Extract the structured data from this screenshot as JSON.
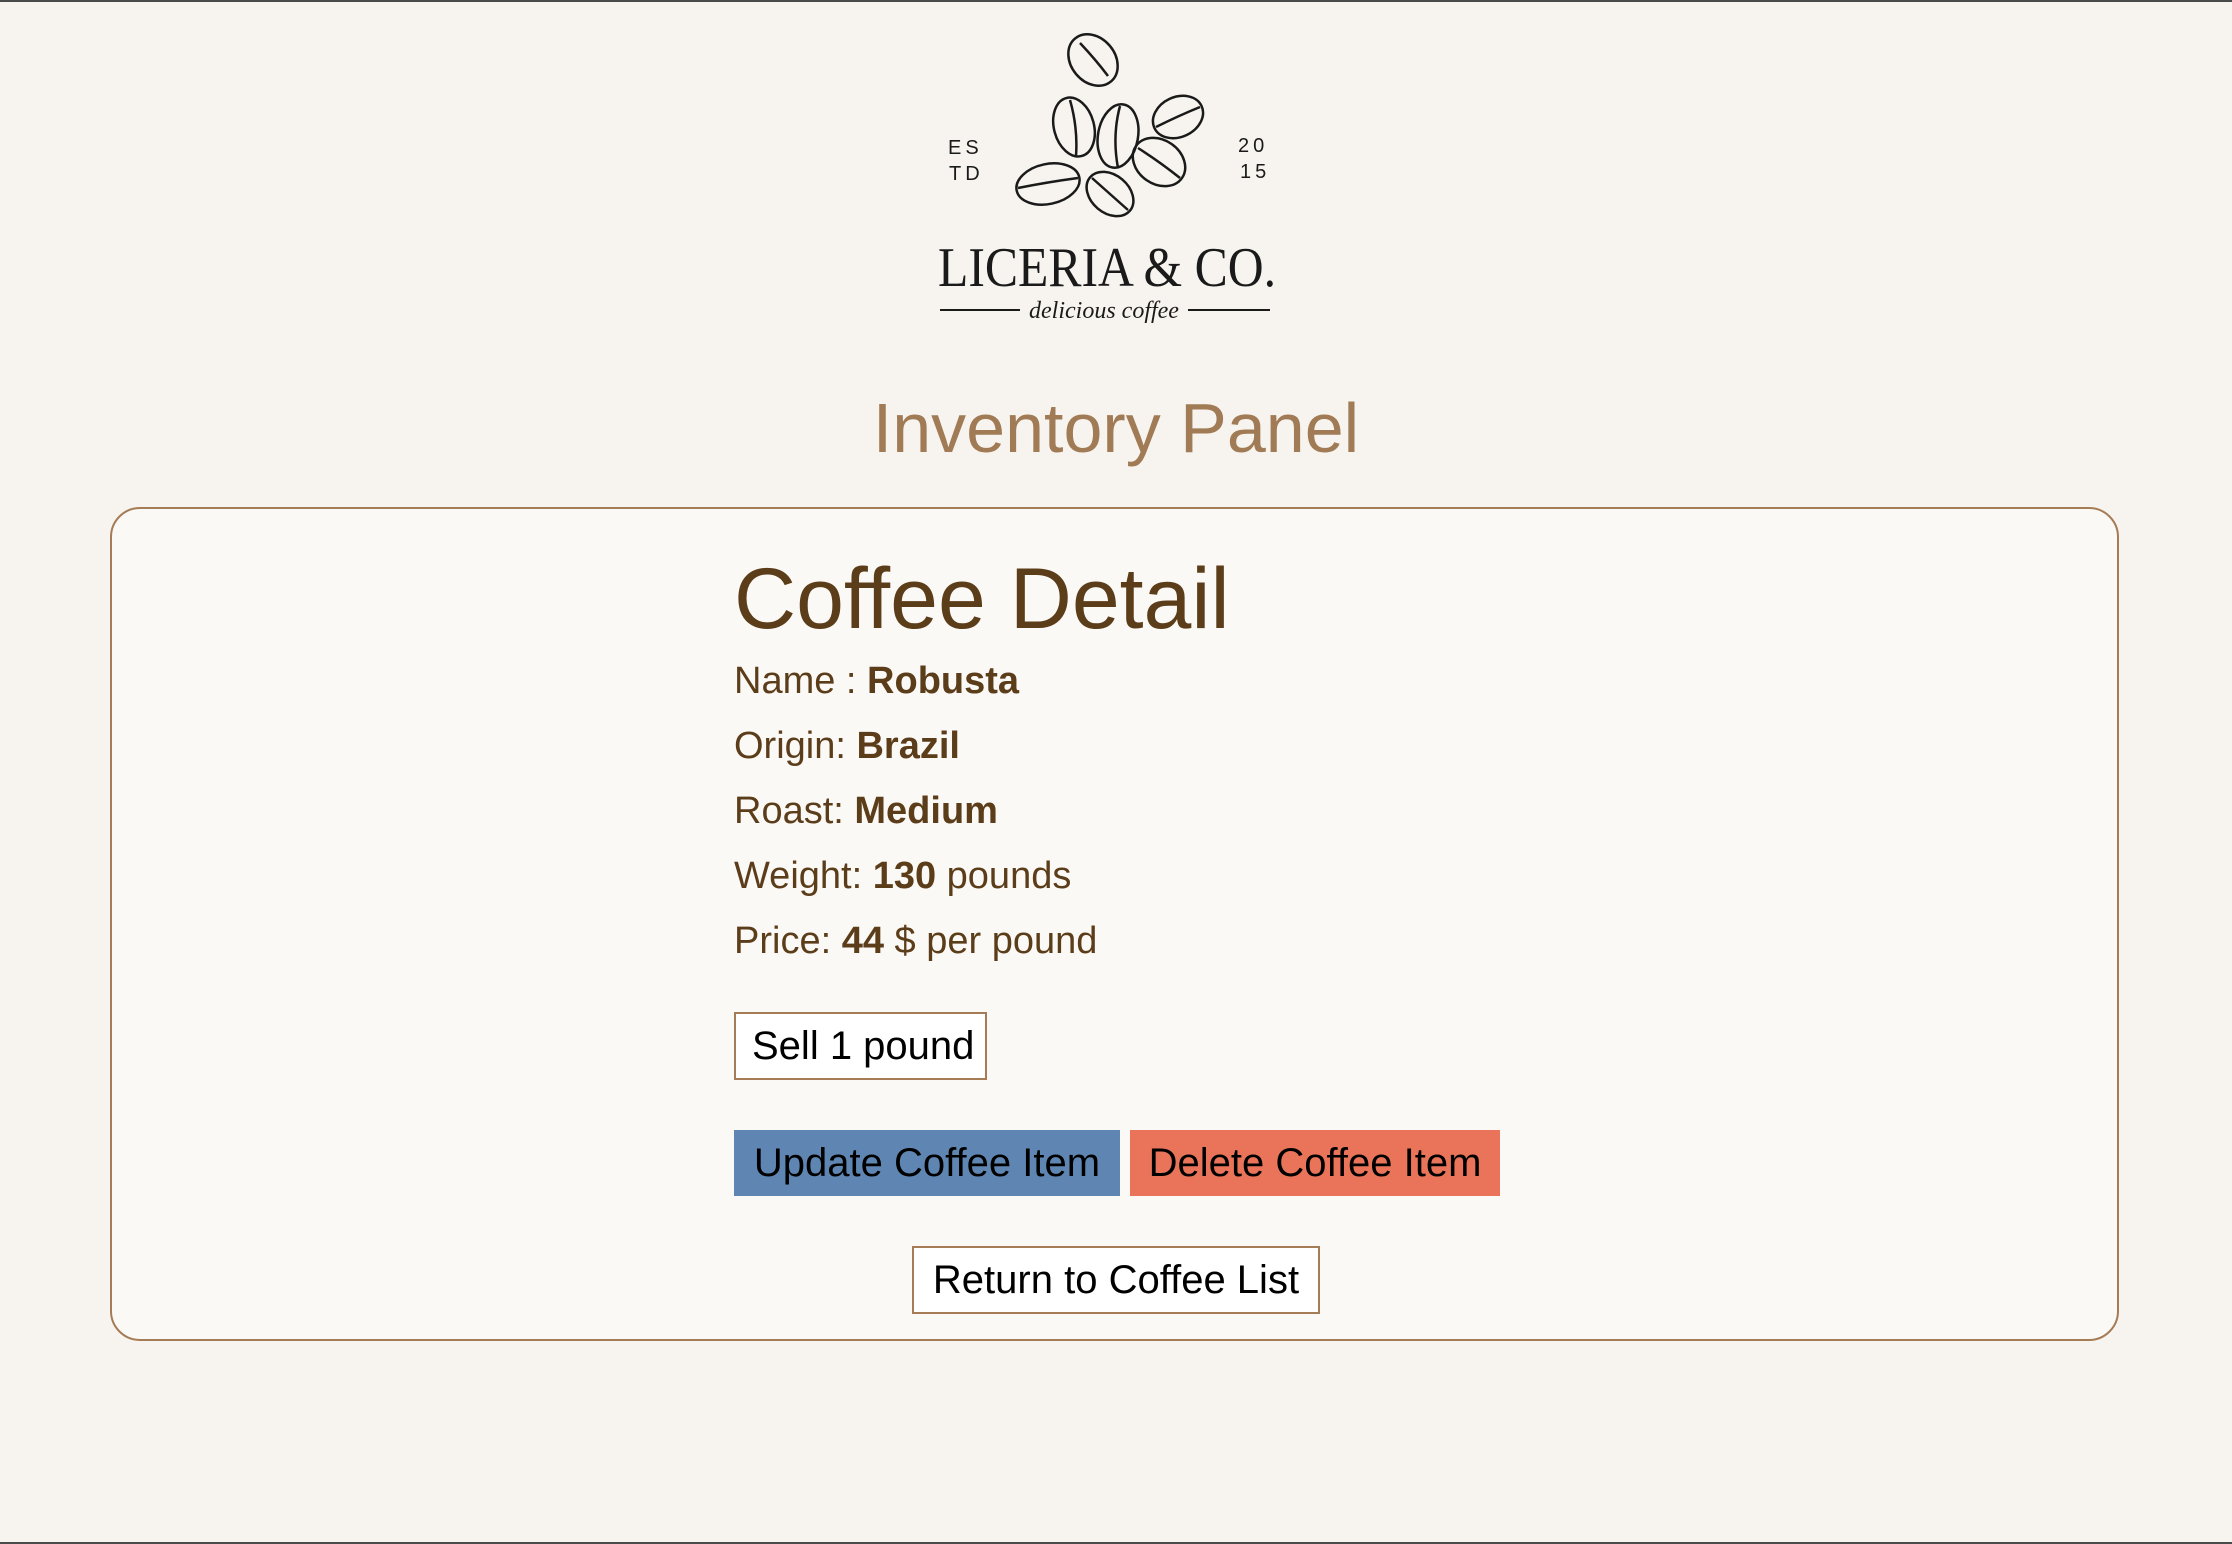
{
  "logo": {
    "icon": "coffee-beans-logo",
    "est_top": "ES",
    "est_bottom": "TD",
    "year_top": "20",
    "year_bottom": "15",
    "brand": "LICERIA & CO.",
    "tagline": "delicious coffee"
  },
  "page_title": "Inventory Panel",
  "detail": {
    "title": "Coffee Detail",
    "name_label": "Name : ",
    "name_value": "Robusta",
    "origin_label": "Origin: ",
    "origin_value": "Brazil",
    "roast_label": "Roast: ",
    "roast_value": "Medium",
    "weight_label": "Weight: ",
    "weight_value": "130",
    "weight_unit": " pounds",
    "price_label": "Price: ",
    "price_value": "44",
    "price_unit": " $ per pound"
  },
  "buttons": {
    "sell": "Sell 1 pound",
    "update": "Update Coffee Item",
    "delete": "Delete Coffee Item",
    "return": "Return to Coffee List"
  },
  "colors": {
    "background": "#f7f4ef",
    "accent_brown": "#a07b55",
    "text_brown": "#5b3d1a",
    "update_blue": "#5f86b2",
    "delete_red": "#e9745a"
  }
}
